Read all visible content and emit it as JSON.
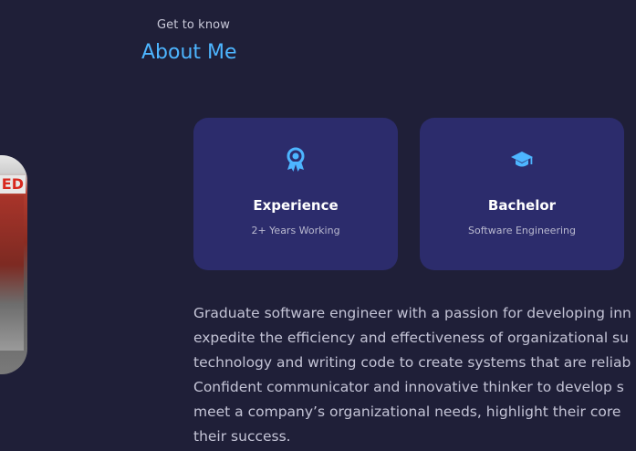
{
  "header": {
    "eyebrow": "Get to know",
    "title": "About Me"
  },
  "photo": {
    "sign_text": "ED"
  },
  "cards": [
    {
      "icon": "award-icon",
      "title": "Experience",
      "subtitle": "2+ Years Working"
    },
    {
      "icon": "graduation-cap-icon",
      "title": "Bachelor",
      "subtitle": "Software Engineering"
    }
  ],
  "bio": {
    "lines": [
      "Graduate software engineer with a passion for developing inn",
      "expedite the efficiency and effectiveness of organizational su",
      "technology and writing code to create systems that are reliab",
      "Confident communicator and innovative thinker to develop s",
      "meet a company’s organizational needs, highlight their core",
      "their success."
    ]
  },
  "colors": {
    "background": "#1f1f38",
    "card": "#2c2c6c",
    "accent": "#4db5ff",
    "text_light": "#c4c4d6"
  }
}
